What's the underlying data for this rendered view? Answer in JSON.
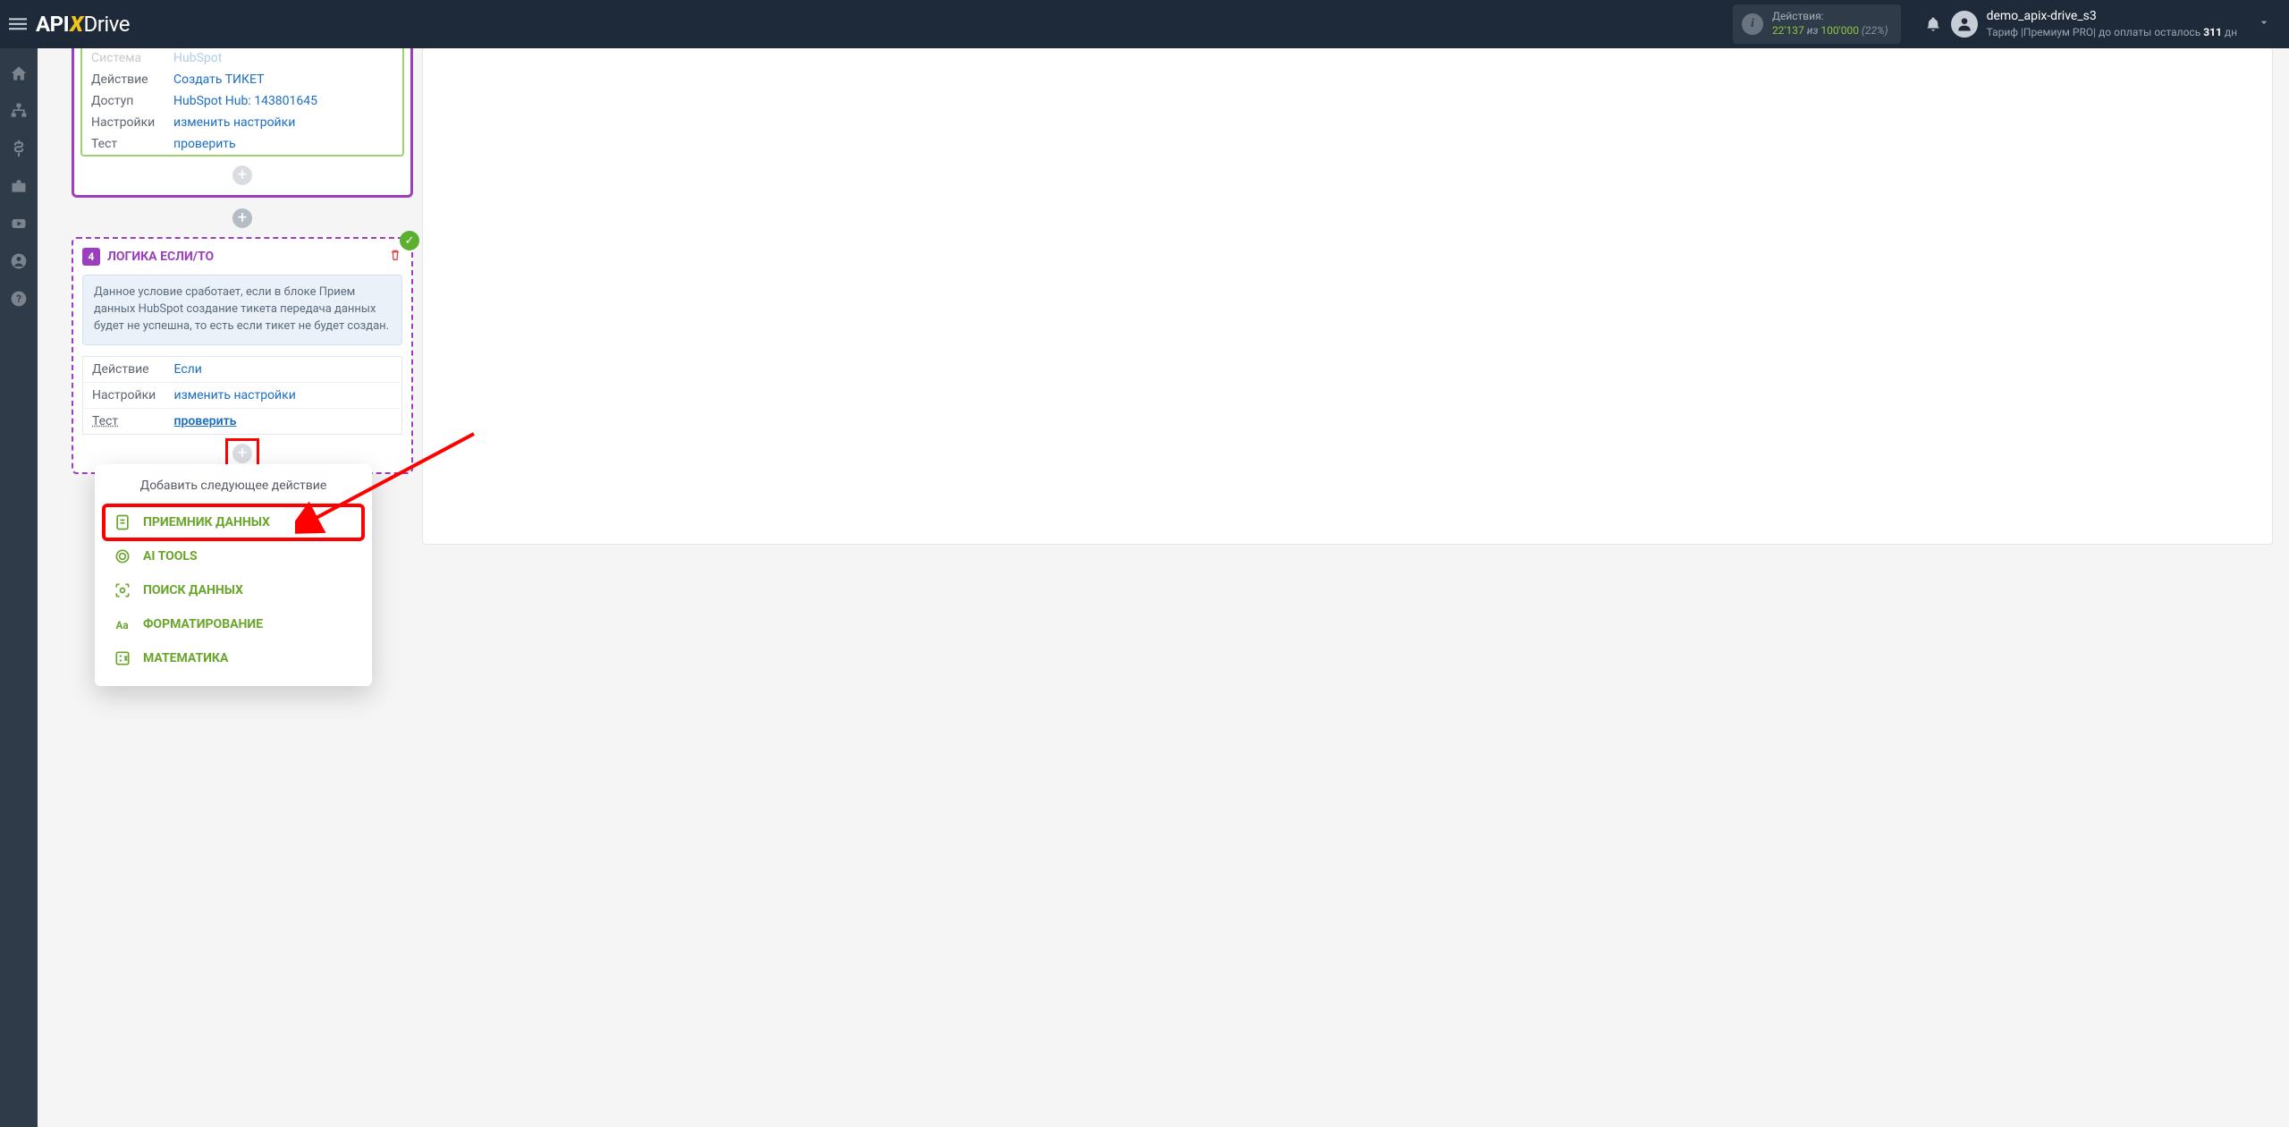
{
  "header": {
    "logo": {
      "part1": "API",
      "part2": "X",
      "part3": "Drive"
    },
    "actions": {
      "label": "Действия:",
      "count1": "22'137",
      "iz": "из",
      "count2": "100'000",
      "pct": "(22%)"
    },
    "user": {
      "name": "demo_apix-drive_s3",
      "plan_prefix": "Тариф |Премиум PRO| до оплаты осталось ",
      "days": "311",
      "days_suffix": " дн"
    }
  },
  "card1": {
    "rows": {
      "system_key": "Система",
      "system_val": "HubSpot",
      "action_key": "Действие",
      "action_val": "Создать ТИКЕТ",
      "access_key": "Доступ",
      "access_val": "HubSpot Hub: 143801645",
      "settings_key": "Настройки",
      "settings_val": "изменить настройки",
      "test_key": "Тест",
      "test_val": "проверить"
    }
  },
  "logic": {
    "step_num": "4",
    "title": "ЛОГИКА ЕСЛИ/ТО",
    "desc": "Данное условие сработает, если в блоке Прием данных HubSpot создание тикета передача данных будет не успешна, то есть если тикет не будет создан.",
    "rows": {
      "action_key": "Действие",
      "action_val": "Если",
      "settings_key": "Настройки",
      "settings_val": "изменить настройки",
      "test_key": "Тест",
      "test_val": "проверить"
    }
  },
  "popup": {
    "title": "Добавить следующее действие",
    "items": {
      "receiver": "ПРИЕМНИК ДАННЫХ",
      "ai": "AI TOOLS",
      "search": "ПОИСК ДАННЫХ",
      "format": "ФОРМАТИРОВАНИЕ",
      "math": "МАТЕМАТИКА"
    }
  }
}
